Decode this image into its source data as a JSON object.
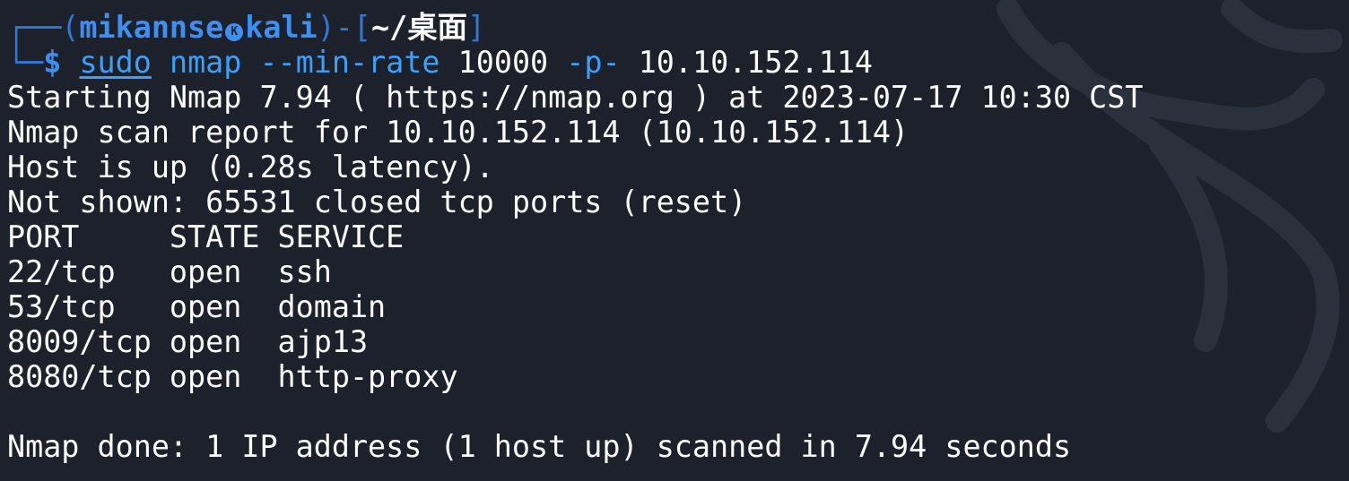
{
  "prompt": {
    "open_paren": "(",
    "user": "mikannse",
    "host": "kali",
    "close_paren_dash": ")-[",
    "cwd": "~/桌面",
    "close_bracket": "]",
    "dollar": "$"
  },
  "command": {
    "program": "sudo",
    "arg1": "nmap",
    "arg2": "--min-rate",
    "arg3": "10000",
    "arg4": "-p-",
    "target": "10.10.152.114"
  },
  "output": {
    "start_line": "Starting Nmap 7.94 ( https://nmap.org ) at 2023-07-17 10:30 CST",
    "report_line": "Nmap scan report for 10.10.152.114 (10.10.152.114)",
    "host_line": "Host is up (0.28s latency).",
    "not_shown_line": "Not shown: 65531 closed tcp ports (reset)",
    "table_header": "PORT     STATE SERVICE",
    "rows": [
      "22/tcp   open  ssh",
      "53/tcp   open  domain",
      "8009/tcp open  ajp13",
      "8080/tcp open  http-proxy"
    ],
    "done_line": "Nmap done: 1 IP address (1 host up) scanned in 7.94 seconds"
  },
  "icons": {
    "kali_symbol": "kali-logo-icon",
    "watermark": "kali-dragon-icon"
  },
  "colors": {
    "background": "#1c212c",
    "prompt_blue": "#3f8ff0",
    "command_blue": "#3e9ff7",
    "text": "#ffffff"
  }
}
